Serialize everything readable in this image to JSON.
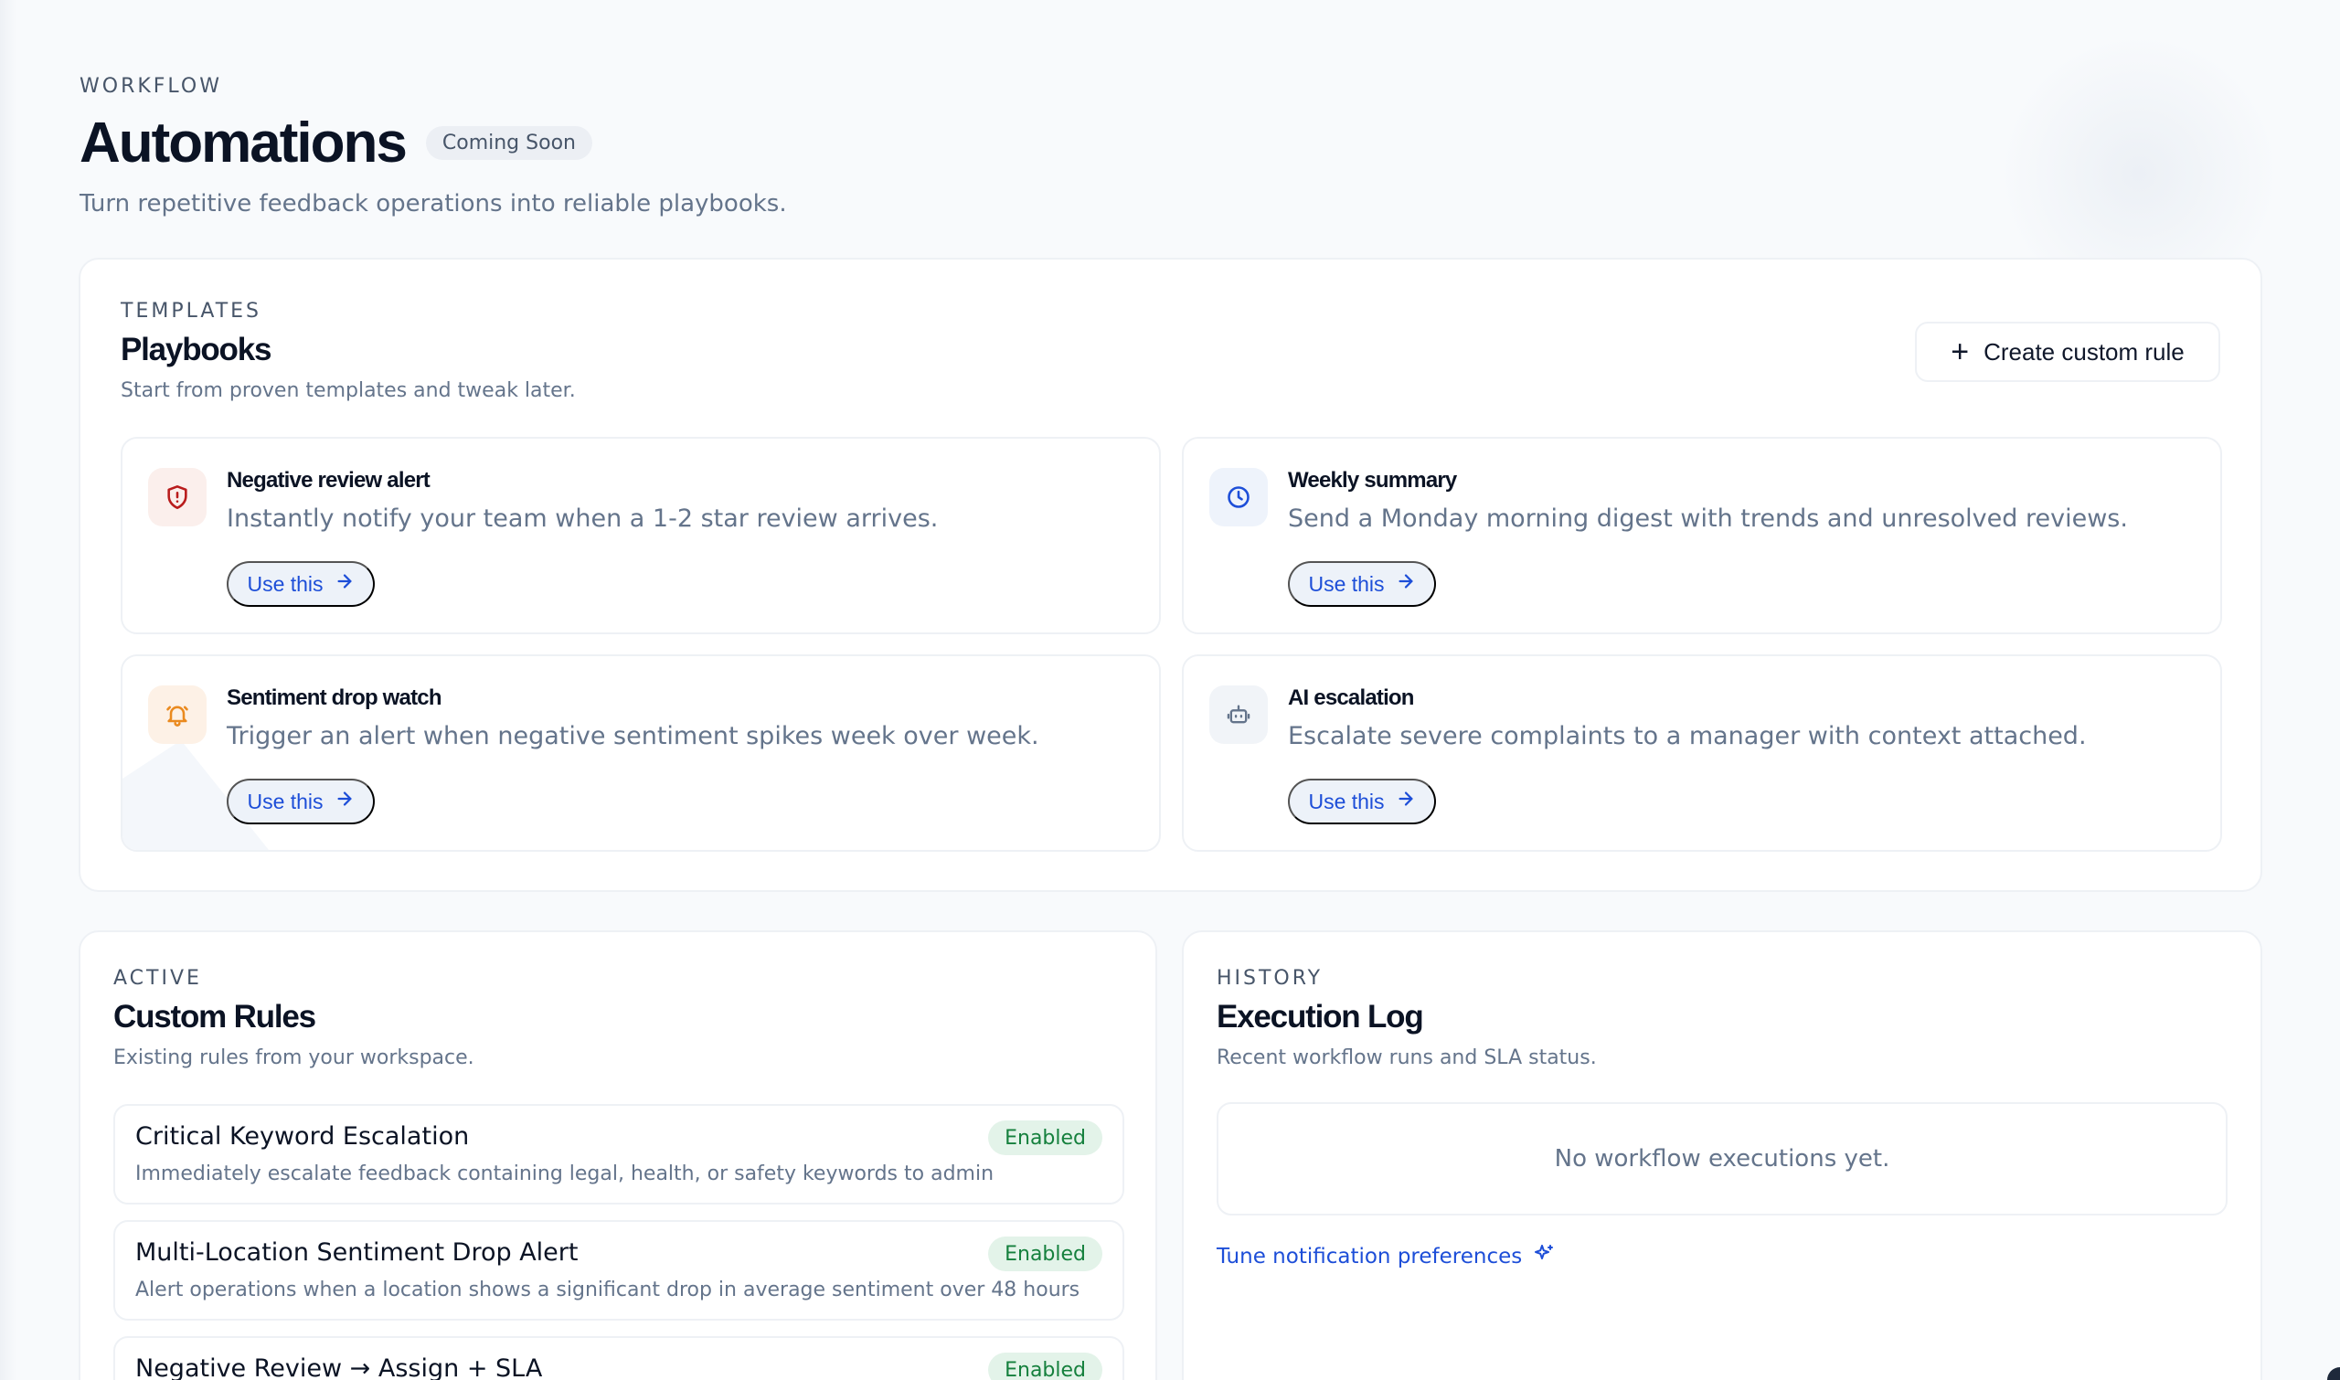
{
  "header": {
    "eyebrow": "WORKFLOW",
    "title": "Automations",
    "badge": "Coming Soon",
    "subtitle": "Turn repetitive feedback operations into reliable playbooks."
  },
  "templates": {
    "eyebrow": "TEMPLATES",
    "title": "Playbooks",
    "subtitle": "Start from proven templates and tweak later.",
    "create_label": "Create custom rule",
    "use_label": "Use this",
    "items": [
      {
        "title": "Negative review alert",
        "desc": "Instantly notify your team when a 1-2 star review arrives.",
        "icon": "shield-alert-icon",
        "color": "#b91c1c"
      },
      {
        "title": "Weekly summary",
        "desc": "Send a Monday morning digest with trends and unresolved reviews.",
        "icon": "clock-icon",
        "color": "#1d4ed8"
      },
      {
        "title": "Sentiment drop watch",
        "desc": "Trigger an alert when negative sentiment spikes week over week.",
        "icon": "bell-icon",
        "color": "#ea8a1f"
      },
      {
        "title": "AI escalation",
        "desc": "Escalate severe complaints to a manager with context attached.",
        "icon": "bot-icon",
        "color": "#64748b"
      }
    ]
  },
  "rules": {
    "eyebrow": "ACTIVE",
    "title": "Custom Rules",
    "subtitle": "Existing rules from your workspace.",
    "items": [
      {
        "title": "Critical Keyword Escalation",
        "desc": "Immediately escalate feedback containing legal, health, or safety keywords to admin",
        "status": "Enabled"
      },
      {
        "title": "Multi-Location Sentiment Drop Alert",
        "desc": "Alert operations when a location shows a significant drop in average sentiment over 48 hours",
        "status": "Enabled"
      },
      {
        "title": "Negative Review → Assign + SLA",
        "desc": "",
        "status": "Enabled"
      }
    ]
  },
  "history": {
    "eyebrow": "HISTORY",
    "title": "Execution Log",
    "subtitle": "Recent workflow runs and SLA status.",
    "empty": "No workflow executions yet.",
    "tune_link": "Tune notification preferences"
  }
}
